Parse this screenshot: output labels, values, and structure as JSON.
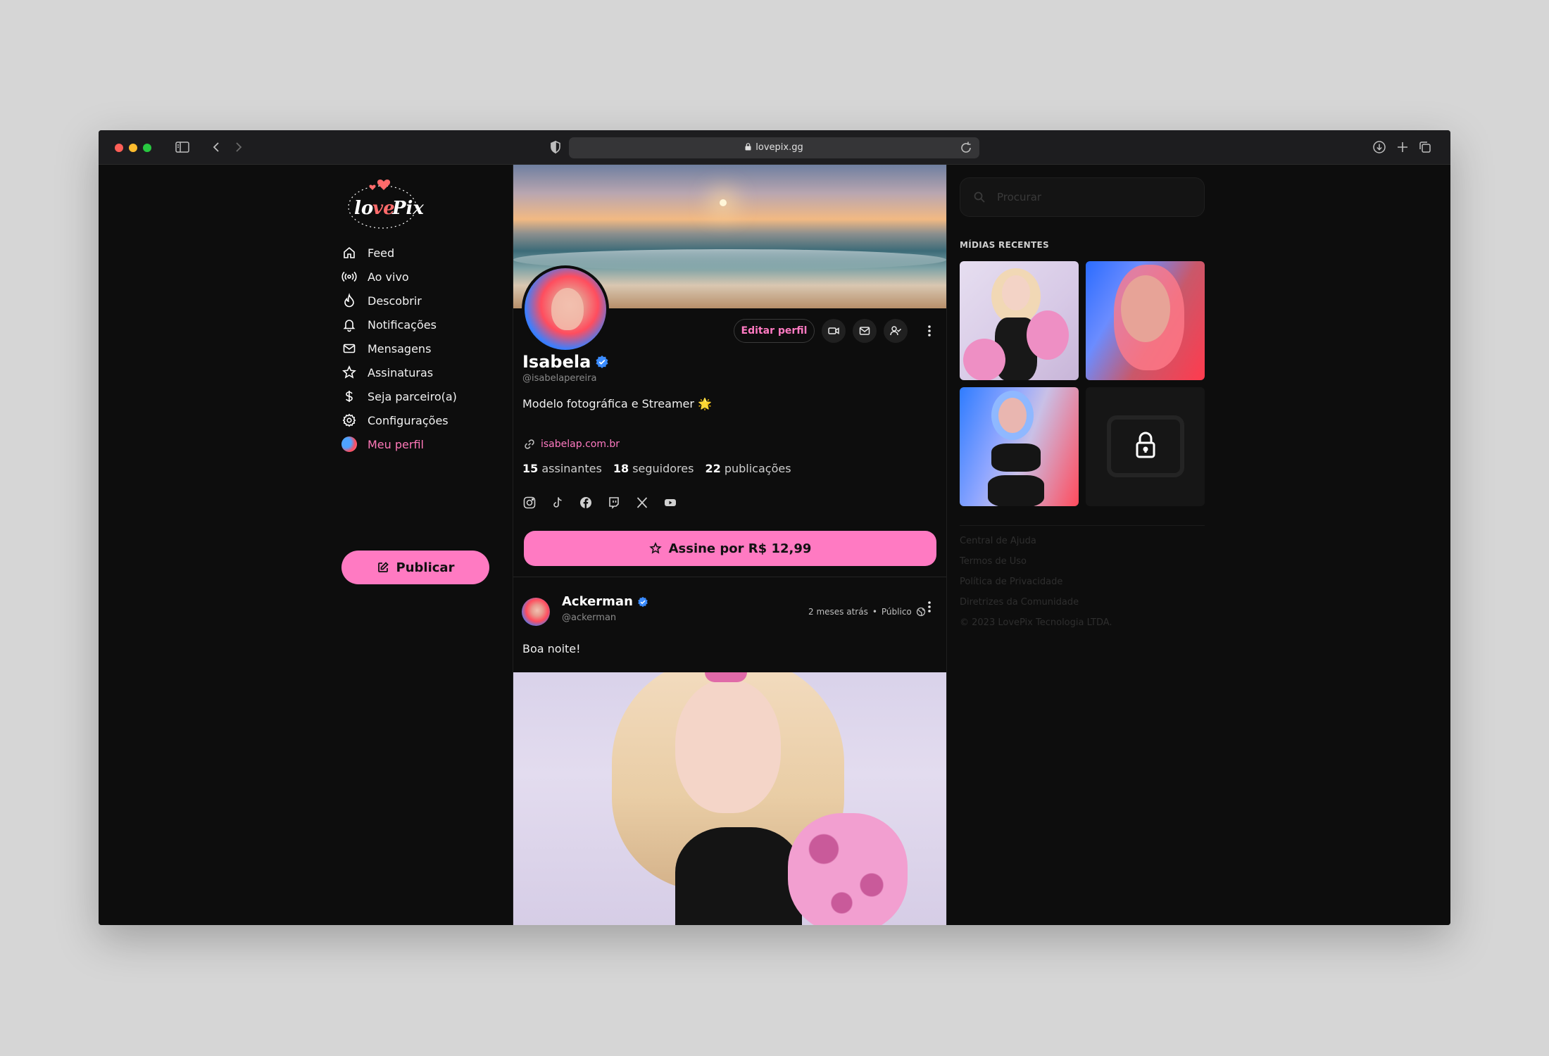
{
  "browser": {
    "url": "lovepix.gg"
  },
  "brand": {
    "logo_text": "lovePix",
    "accent": "#ff7ac2"
  },
  "sidebar": {
    "items": [
      {
        "label": "Feed",
        "icon": "home-icon"
      },
      {
        "label": "Ao vivo",
        "icon": "broadcast-icon"
      },
      {
        "label": "Descobrir",
        "icon": "flame-icon"
      },
      {
        "label": "Notificações",
        "icon": "bell-icon"
      },
      {
        "label": "Mensagens",
        "icon": "mail-icon"
      },
      {
        "label": "Assinaturas",
        "icon": "star-icon"
      },
      {
        "label": "Seja parceiro(a)",
        "icon": "dollar-icon"
      },
      {
        "label": "Configurações",
        "icon": "gear-icon"
      },
      {
        "label": "Meu perfil",
        "icon": "avatar",
        "active": true
      }
    ],
    "publish_label": "Publicar"
  },
  "profile": {
    "edit_label": "Editar perfil",
    "name": "Isabela",
    "handle": "@isabelapereira",
    "bio": "Modelo fotográfica e Streamer 🌟",
    "website": "isabelap.com.br",
    "stats": {
      "subscribers_count": "15",
      "subscribers_label": "assinantes",
      "followers_count": "18",
      "followers_label": "seguidores",
      "posts_count": "22",
      "posts_label": "publicações"
    },
    "socials": [
      "instagram-icon",
      "tiktok-icon",
      "facebook-icon",
      "twitch-icon",
      "x-icon",
      "youtube-icon"
    ],
    "subscribe_label": "Assine por R$ 12,99"
  },
  "post": {
    "author": "Ackerman",
    "handle": "@ackerman",
    "time": "2 meses atrás",
    "separator": "•",
    "visibility": "Público",
    "text": "Boa noite!"
  },
  "right": {
    "search_placeholder": "Procurar",
    "recent_title": "MÍDIAS RECENTES",
    "footer_links": [
      "Central de Ajuda",
      "Termos de Uso",
      "Política de Privacidade",
      "Diretrizes da Comunidade",
      "© 2023 LovePix Tecnologia LTDA."
    ]
  }
}
